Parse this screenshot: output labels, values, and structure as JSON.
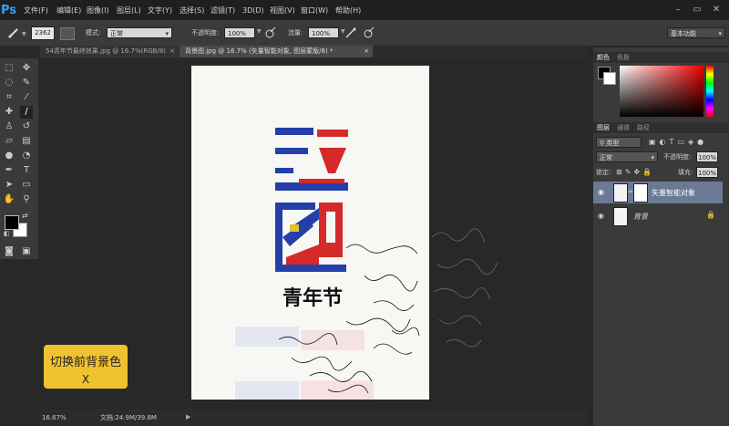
{
  "app": {
    "logo": "Ps"
  },
  "menu": [
    "文件(F)",
    "编辑(E)",
    "图像(I)",
    "图层(L)",
    "文字(Y)",
    "选择(S)",
    "滤镜(T)",
    "3D(D)",
    "视图(V)",
    "窗口(W)",
    "帮助(H)"
  ],
  "window_controls": {
    "minimize": "–",
    "maximize": "▭",
    "close": "✕"
  },
  "options": {
    "brush_size": "2362",
    "mode_label": "模式:",
    "mode_value": "正常",
    "opacity_label": "不透明度:",
    "opacity_value": "100%",
    "flow_label": "流量:",
    "flow_value": "100%",
    "workspace": "基本功能"
  },
  "tabs": [
    {
      "label": "54青年节最终效果.jpg @ 16.7%(RGB/8)",
      "close": "×"
    },
    {
      "label": "背景图.jpg @ 16.7% (矢量智能对象, 图层蒙版/8) *",
      "close": "×"
    }
  ],
  "canvas": {
    "title_text": "青年节"
  },
  "status": {
    "zoom": "16.67%",
    "doc": "文档:24.9M/39.8M"
  },
  "panels": {
    "color_tabs": [
      "颜色",
      "色板"
    ],
    "layer_tabs": [
      "图层",
      "通道",
      "路径"
    ],
    "filter_kind": "类型",
    "blend_mode": "正常",
    "opacity_label": "不透明度:",
    "opacity_value": "100%",
    "lock_label": "锁定:",
    "fill_label": "填充:",
    "fill_value": "100%",
    "layers": [
      {
        "name": "矢量智能对象",
        "selected": true
      },
      {
        "name": "背景",
        "selected": false
      }
    ]
  },
  "tooltip": {
    "line1": "切换前背景色",
    "line2": "X"
  },
  "colors": {
    "accent_blue": "#2440a8",
    "accent_red": "#d42a2a",
    "tooltip_bg": "#f1c230"
  }
}
